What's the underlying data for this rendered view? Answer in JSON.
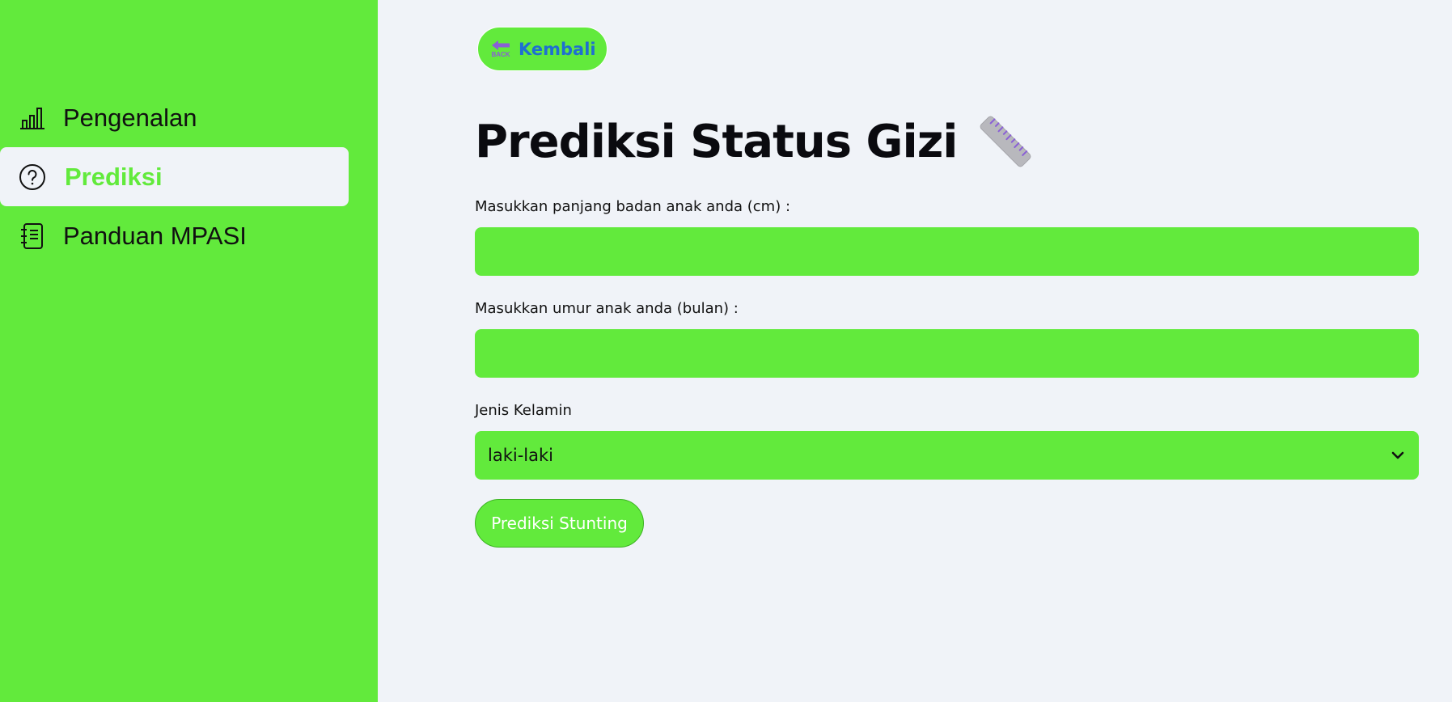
{
  "sidebar": {
    "items": [
      {
        "label": "Pengenalan",
        "icon": "bar-chart-icon",
        "active": false
      },
      {
        "label": "Prediksi",
        "icon": "question-circle-icon",
        "active": true
      },
      {
        "label": "Panduan MPASI",
        "icon": "notebook-icon",
        "active": false
      }
    ]
  },
  "main": {
    "back_button": {
      "label": "Kembali",
      "icon_text": "BACK",
      "icon": "back-arrow-icon"
    },
    "title": "Prediksi Status Gizi",
    "title_icon": "ruler-icon",
    "fields": {
      "length": {
        "label": "Masukkan panjang badan anak anda (cm) :",
        "value": ""
      },
      "age": {
        "label": "Masukkan umur anak anda (bulan) :",
        "value": ""
      },
      "gender": {
        "label": "Jenis Kelamin",
        "selected": "laki-laki"
      }
    },
    "submit_label": "Prediksi Stunting"
  },
  "colors": {
    "accent": "#62ea3c",
    "background": "#f0f3f8",
    "back_label": "#1f6fd1",
    "back_icon": "#8a5fd6"
  }
}
